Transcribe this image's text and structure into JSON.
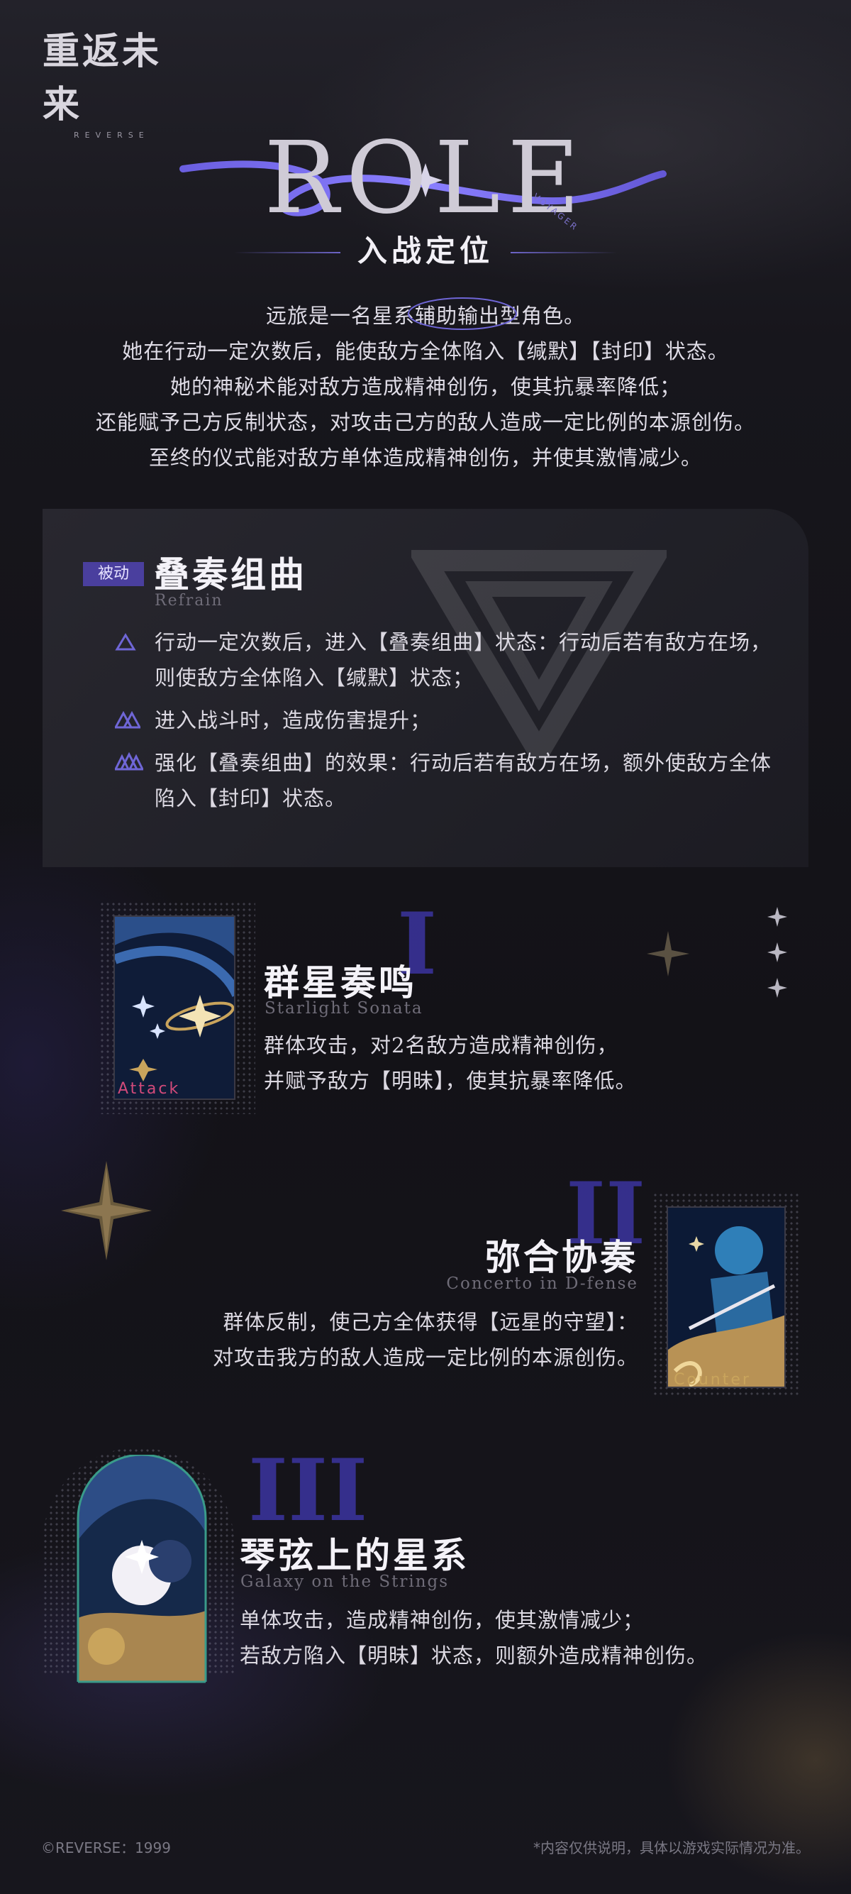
{
  "brand": {
    "logo_cn": "重返未来",
    "logo_en": "REVERSE"
  },
  "header": {
    "role_word": "ROLE",
    "role_tag": "VOYAGER",
    "section_title": "入战定位"
  },
  "intro": [
    "远旅是一名星系辅助输出型角色。",
    "她在行动一定次数后，能使敌方全体陷入【缄默】【封印】状态。",
    "她的神秘术能对敌方造成精神创伤，使其抗暴率降低；",
    "还能赋予己方反制状态，对攻击己方的敌人造成一定比例的本源创伤。",
    "至终的仪式能对敌方单体造成精神创伤，并使其激情减少。"
  ],
  "passive": {
    "badge": "被动",
    "title": "叠奏组曲",
    "subtitle": "Refrain",
    "items": [
      {
        "icon": "tier-1-triangle-icon",
        "text": "行动一定次数后，进入【叠奏组曲】状态：行动后若有敌方在场，则使敌方全体陷入【缄默】状态；"
      },
      {
        "icon": "tier-2-triangle-icon",
        "text": "进入战斗时，造成伤害提升；"
      },
      {
        "icon": "tier-3-triangle-icon",
        "text": "强化【叠奏组曲】的效果：行动后若有敌方在场，额外使敌方全体陷入【封印】状态。"
      }
    ]
  },
  "skills": [
    {
      "numeral": "I",
      "title": "群星奏鸣",
      "subtitle": "Starlight Sonata",
      "card_label": "Attack",
      "lines": [
        "群体攻击，对2名敌方造成精神创伤，",
        "并赋予敌方【明昧】，使其抗暴率降低。"
      ]
    },
    {
      "numeral": "II",
      "title": "弥合协奏",
      "subtitle": "Concerto in D-fense",
      "card_label": "Counter",
      "lines": [
        "群体反制，使己方全体获得【远星的守望】：",
        "对攻击我方的敌人造成一定比例的本源创伤。"
      ]
    },
    {
      "numeral": "III",
      "title": "琴弦上的星系",
      "subtitle": "Galaxy on the Strings",
      "card_label": "",
      "lines": [
        "单体攻击，造成精神创伤，使其激情减少；",
        "若敌方陷入【明昧】状态，则额外造成精神创伤。"
      ]
    }
  ],
  "footer": {
    "copyright": "©REVERSE：1999",
    "disclaimer": "*内容仅供说明，具体以游戏实际情况为准。"
  },
  "colors": {
    "accent": "#4a3f9e",
    "gold": "#b69660",
    "bg": "#141318"
  }
}
